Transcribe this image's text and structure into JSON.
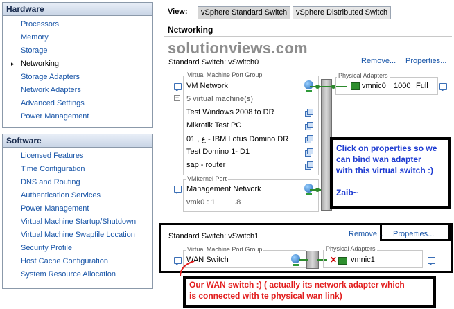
{
  "hardware": {
    "title": "Hardware",
    "items": [
      "Processors",
      "Memory",
      "Storage",
      "Networking",
      "Storage Adapters",
      "Network Adapters",
      "Advanced Settings",
      "Power Management"
    ],
    "active": "Networking"
  },
  "software": {
    "title": "Software",
    "items": [
      "Licensed Features",
      "Time Configuration",
      "DNS and Routing",
      "Authentication Services",
      "Power Management",
      "Virtual Machine Startup/Shutdown",
      "Virtual Machine Swapfile Location",
      "Security Profile",
      "Host Cache Configuration",
      "System Resource Allocation"
    ]
  },
  "view": {
    "label": "View:",
    "standard_btn": "vSphere Standard Switch",
    "distributed_btn": "vSphere Distributed Switch"
  },
  "networking_title": "Networking",
  "watermark": "solutionviews.com",
  "switch0": {
    "title": "Standard Switch: vSwitch0",
    "remove": "Remove...",
    "properties": "Properties...",
    "vm_group_legend": "Virtual Machine Port Group",
    "vm_network": "VM Network",
    "vm_count": "5 virtual machine(s)",
    "vms": [
      "Test Windows 2008 fo DR",
      "Mikrotik Test PC",
      "ع ,    01 - IBM Lotus Domino DR",
      "Test Domino 1- D1",
      "sap - router"
    ],
    "vmkernel_legend": "VMkernel Port",
    "mgmt_network": "Management Network",
    "vmk_ip": "vmk0 : 1         .8",
    "phys_legend": "Physical Adapters",
    "nic_name": "vmnic0",
    "nic_speed": "1000",
    "nic_duplex": "Full"
  },
  "switch1": {
    "title": "Standard Switch: vSwitch1",
    "remove": "Remove...",
    "properties": "Properties...",
    "vm_group_legend": "Virtual Machine Port Group",
    "port_group": "WAN Switch",
    "phys_legend": "Physical Adapters",
    "nic_name": "vmnic1"
  },
  "annotations": {
    "blue_note": [
      "Click on properties so we",
      "can bind wan adapter",
      "with this virtual switch :)",
      "",
      "Zaib~"
    ],
    "red_note": [
      "Our WAN switch :)  ( actually its network adapter which",
      "is connected with te physical wan link)"
    ]
  },
  "colors": {
    "accent": "#1a56a8",
    "annotation_blue": "#1d3bd1",
    "annotation_red": "#e21d1d"
  }
}
